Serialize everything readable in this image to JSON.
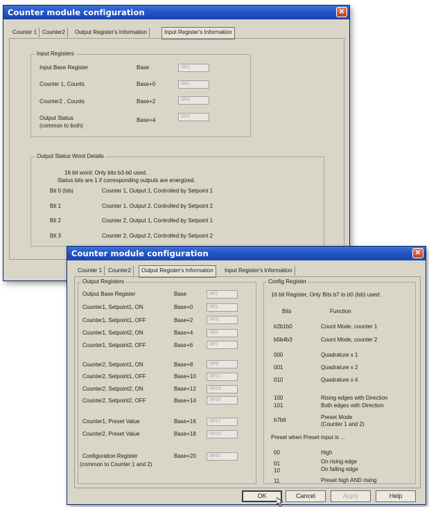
{
  "title": "Counter module configuration",
  "tabs": [
    "Counter 1",
    "Counter2",
    "Output Register's Information",
    "Input Register's Information"
  ],
  "input_dialog": {
    "input_registers": {
      "title": "Input Registers",
      "rows": [
        {
          "label": "Input Base Register",
          "offset": "Base",
          "value": "0R1"
        },
        {
          "label": "Counter 1, Counts",
          "offset": "Base+0",
          "value": "0R1"
        },
        {
          "label": "Counter2 , Counts",
          "offset": "Base+2",
          "value": "0R3"
        },
        {
          "label": "Output Status",
          "label2": "(common to both)",
          "offset": "Base+4",
          "value": "0R5"
        }
      ]
    },
    "status_word": {
      "title": "Output Status Word Details",
      "line1": "16 bit word; Only bits b3-b0 used.",
      "line2": "Status bits are 1 if corresponding outputs are energized.",
      "bits": [
        {
          "bit": "Bit 0 (lsb)",
          "desc": "Counter 1, Output 1, Controlled by Setpoint 1"
        },
        {
          "bit": "Bit 1",
          "desc": "Counter 1, Output 2, Controlled by Setpoint 2"
        },
        {
          "bit": "Bit 2",
          "desc": "Counter 2, Output 1, Controlled by Setpoint 1"
        },
        {
          "bit": "Bit 3",
          "desc": "Counter 2, Output 2, Controlled by Setpoint 2"
        }
      ]
    }
  },
  "output_dialog": {
    "output_registers": {
      "title": "Output Registers",
      "rows": [
        {
          "label": "Output Base Register",
          "offset": "Base",
          "value": "0R1"
        },
        {
          "label": "Counter1, Setpoint1, ON",
          "offset": "Base+0",
          "value": "0R1"
        },
        {
          "label": "Counter1, Setpoint1, OFF",
          "offset": "Base+2",
          "value": "0R3"
        },
        {
          "label": "Counter1, Setpoint2, ON",
          "offset": "Base+4",
          "value": "0R5"
        },
        {
          "label": "Counter1, Setpoint2, OFF",
          "offset": "Base+6",
          "value": "0R7"
        },
        {
          "label": "Counter2, Setpoint1, ON",
          "offset": "Base+8",
          "value": "0R9"
        },
        {
          "label": "Counter2, Setpoint1, OFF",
          "offset": "Base+10",
          "value": "0R11"
        },
        {
          "label": "Counter2, Setpoint2, ON",
          "offset": "Base+12",
          "value": "0R13"
        },
        {
          "label": "Counter2, Setpoint2, OFF",
          "offset": "Base+14",
          "value": "0R15"
        },
        {
          "label": "Counter1, Preset Value",
          "offset": "Base+16",
          "value": "0R17"
        },
        {
          "label": "Counter2, Preset Value",
          "offset": "Base+18",
          "value": "0R19"
        },
        {
          "label": "Configuration Register",
          "label2": "(common to Counter 1 and 2)",
          "offset": "Base+20",
          "value": "0R21"
        }
      ]
    },
    "config_register": {
      "title": "Config Register",
      "intro": "16 bit Register, Only Bits b7 to b0 (lsb) used:",
      "col_bits": "Bits",
      "col_function": "Function",
      "rows": [
        {
          "bits": "b2b1b0",
          "func": "Count Mode, counter 1"
        },
        {
          "bits": "b5b4b3",
          "func": "Count Mode, counter 2"
        },
        {
          "bits": "000",
          "func": "Quadrature x 1"
        },
        {
          "bits": "001",
          "func": "Quadrature x 2"
        },
        {
          "bits": "010",
          "func": "Quadrature x 4"
        },
        {
          "bits": "100",
          "func": "Rising edges with Direction"
        },
        {
          "bits": "101",
          "func": "Both edges with Direction"
        },
        {
          "bits": "b7b6",
          "func": "Preset Mode",
          "func2": "(Counter 1 and 2)"
        }
      ],
      "preset_title": "Preset when Preset Input is ...",
      "preset_rows": [
        {
          "bits": "00",
          "func": "High"
        },
        {
          "bits": "01",
          "func": "On rising edge"
        },
        {
          "bits": "10",
          "func": "On falling edge"
        },
        {
          "bits": "11",
          "func": "Preset high AND rising"
        }
      ]
    },
    "buttons": {
      "ok": "OK",
      "cancel": "Cancel",
      "apply": "Apply",
      "help": "Help"
    }
  }
}
